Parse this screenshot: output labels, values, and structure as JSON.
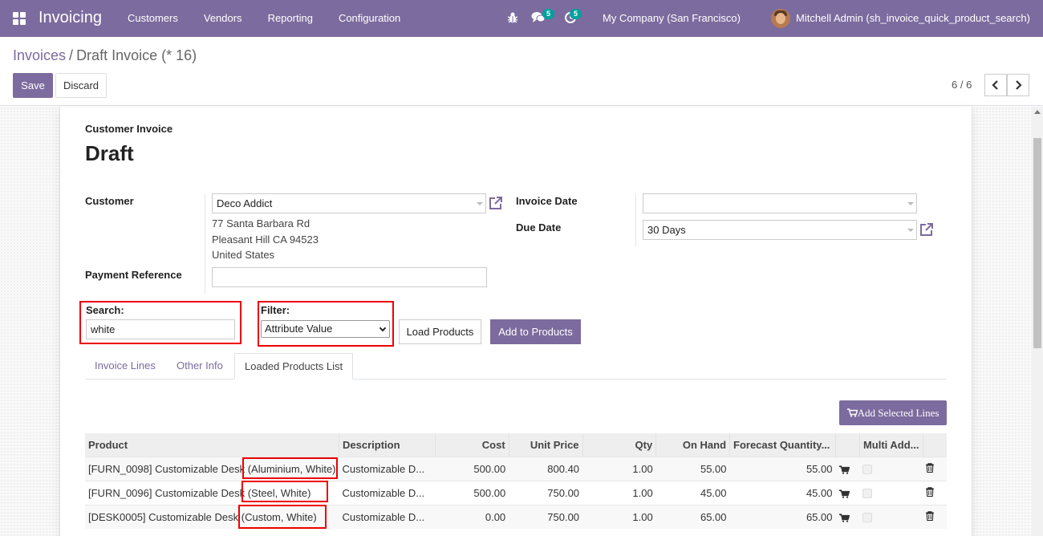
{
  "navbar": {
    "app_name": "Invoicing",
    "menu": [
      "Customers",
      "Vendors",
      "Reporting",
      "Configuration"
    ],
    "messages_count": "5",
    "activities_count": "5",
    "company": "My Company (San Francisco)",
    "user": "Mitchell Admin (sh_invoice_quick_product_search)"
  },
  "control_panel": {
    "breadcrumb_parent": "Invoices",
    "breadcrumb_separator": "/",
    "breadcrumb_current": "Draft Invoice (* 16)",
    "save_label": "Save",
    "discard_label": "Discard",
    "pager": "6 / 6"
  },
  "form": {
    "doc_type": "Customer Invoice",
    "status": "Draft",
    "customer_label": "Customer",
    "customer_value": "Deco Addict",
    "address": [
      "77 Santa Barbara Rd",
      "Pleasant Hill CA 94523",
      "United States"
    ],
    "payment_reference_label": "Payment Reference",
    "payment_reference_value": "",
    "invoice_date_label": "Invoice Date",
    "invoice_date_value": "",
    "due_date_label": "Due Date",
    "due_date_value": "30 Days"
  },
  "quick_search": {
    "search_label": "Search:",
    "search_value": "white",
    "filter_label": "Filter:",
    "filter_value": "Attribute Value",
    "load_button": "Load Products",
    "add_button": "Add to Products"
  },
  "tabs": [
    "Invoice Lines",
    "Other Info",
    "Loaded Products List"
  ],
  "loaded_products": {
    "add_selected_lines": "Add Selected Lines",
    "columns": [
      "Product",
      "Description",
      "Cost",
      "Unit Price",
      "Qty",
      "On Hand",
      "Forecast Quantity...",
      "",
      "Multi Add...",
      ""
    ],
    "rows": [
      {
        "product_ref": "[FURN_0098] Customizable Desk ",
        "variant": "(Aluminium, White)",
        "description": "Customizable D...",
        "cost": "500.00",
        "unit_price": "800.40",
        "qty": "1.00",
        "on_hand": "55.00",
        "forecast": "55.00"
      },
      {
        "product_ref": "[FURN_0096] Customizable Desk ",
        "variant": "(Steel, White)",
        "description": "Customizable D...",
        "cost": "500.00",
        "unit_price": "750.00",
        "qty": "1.00",
        "on_hand": "45.00",
        "forecast": "45.00"
      },
      {
        "product_ref": "[DESK0005] Customizable Desk ",
        "variant": "(Custom, White)",
        "description": "Customizable D...",
        "cost": "0.00",
        "unit_price": "750.00",
        "qty": "1.00",
        "on_hand": "65.00",
        "forecast": "65.00"
      }
    ]
  },
  "colors": {
    "brand": "#7c6b9e",
    "badge": "#00a09d",
    "highlight": "#ee0000"
  }
}
